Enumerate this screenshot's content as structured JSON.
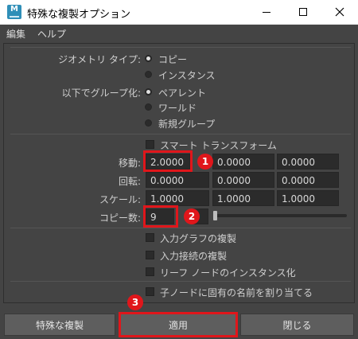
{
  "window": {
    "title": "特殊な複製オプション",
    "icon_letter": "M"
  },
  "menu": [
    "編集",
    "ヘルプ"
  ],
  "geometry_type": {
    "label": "ジオメトリ タイプ:",
    "options": [
      "コピー",
      "インスタンス"
    ],
    "selected": 0
  },
  "group_under": {
    "label": "以下でグループ化:",
    "options": [
      "ペアレント",
      "ワールド",
      "新規グループ"
    ],
    "selected": 0
  },
  "smart_transform": {
    "label": "スマート トランスフォーム",
    "checked": false
  },
  "translate": {
    "label": "移動:",
    "values": [
      "2.0000",
      "0.0000",
      "0.0000"
    ]
  },
  "rotate": {
    "label": "回転:",
    "values": [
      "0.0000",
      "0.0000",
      "0.0000"
    ]
  },
  "scale": {
    "label": "スケール:",
    "values": [
      "1.0000",
      "1.0000",
      "1.0000"
    ]
  },
  "copies": {
    "label": "コピー数:",
    "value": "9",
    "slider_fraction": 0.0
  },
  "checkboxes": [
    {
      "label": "入力グラフの複製",
      "checked": false
    },
    {
      "label": "入力接続の複製",
      "checked": false
    },
    {
      "label": "リーフ ノードのインスタンス化",
      "checked": false
    },
    {
      "label": "子ノードに固有の名前を割り当てる",
      "checked": false
    }
  ],
  "buttons": {
    "special_duplicate": "特殊な複製",
    "apply": "適用",
    "close": "閉じる"
  },
  "annotations": {
    "badge1": "1",
    "badge2": "2",
    "badge3": "3",
    "highlight_color": "#e0161b"
  }
}
